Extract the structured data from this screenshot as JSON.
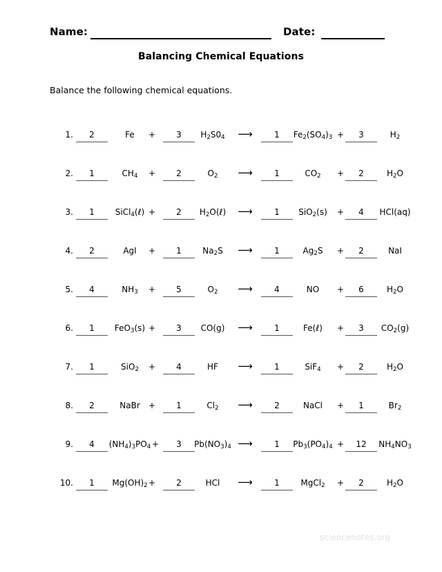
{
  "header": {
    "name_label": "Name:",
    "date_label": "Date:"
  },
  "title": "Balancing Chemical Equations",
  "instruction": "Balance the following chemical equations.",
  "footer": {
    "watermark": "sciencenotes.org"
  },
  "symbols": {
    "plus": "+",
    "arrow": "⟶"
  },
  "equations": [
    {
      "number": "1.",
      "coef1": "2",
      "species1": "Fe",
      "coef2": "3",
      "species2": "H<sub>2</sub>S0<sub>4</sub>",
      "coef3": "1",
      "species3": "Fe<sub>2</sub>(SO<sub>4</sub>)<sub>3</sub>",
      "coef4": "3",
      "species4": "H<sub>2</sub>"
    },
    {
      "number": "2.",
      "coef1": "1",
      "species1": "CH<sub>4</sub>",
      "coef2": "2",
      "species2": "O<sub>2</sub>",
      "coef3": "1",
      "species3": "CO<sub>2</sub>",
      "coef4": "2",
      "species4": "H<sub>2</sub>O"
    },
    {
      "number": "3.",
      "coef1": "1",
      "species1": "SiCl<sub>4</sub>(ℓ)",
      "coef2": "2",
      "species2": "H<sub>2</sub>O(ℓ)",
      "coef3": "1",
      "species3": "SiO<sub>2</sub>(s)",
      "coef4": "4",
      "species4": "HCl(aq)"
    },
    {
      "number": "4.",
      "coef1": "2",
      "species1": "AgI",
      "coef2": "1",
      "species2": "Na<sub>2</sub>S",
      "coef3": "1",
      "species3": "Ag<sub>2</sub>S",
      "coef4": "2",
      "species4": "NaI"
    },
    {
      "number": "5.",
      "coef1": "4",
      "species1": "NH<sub>3</sub>",
      "coef2": "5",
      "species2": "O<sub>2</sub>",
      "coef3": "4",
      "species3": "NO",
      "coef4": "6",
      "species4": "H<sub>2</sub>O"
    },
    {
      "number": "6.",
      "coef1": "1",
      "species1": "FeO<sub>3</sub>(s)",
      "coef2": "3",
      "species2": "CO(g)",
      "coef3": "1",
      "species3": "Fe(ℓ)",
      "coef4": "3",
      "species4": "CO<sub>2</sub>(g)"
    },
    {
      "number": "7.",
      "coef1": "1",
      "species1": "SiO<sub>2</sub>",
      "coef2": "4",
      "species2": "HF",
      "coef3": "1",
      "species3": "SiF<sub>4</sub>",
      "coef4": "2",
      "species4": "H<sub>2</sub>O"
    },
    {
      "number": "8.",
      "coef1": "2",
      "species1": "NaBr",
      "coef2": "1",
      "species2": "Cl<sub>2</sub>",
      "coef3": "2",
      "species3": "NaCl",
      "coef4": "1",
      "species4": "Br<sub>2</sub>"
    },
    {
      "number": "9.",
      "coef1": "4",
      "species1": "(NH<sub>4</sub>)<sub>3</sub>PO<sub>4</sub>",
      "coef2": "3",
      "species2": "Pb(NO<sub>3</sub>)<sub>4</sub>",
      "coef3": "1",
      "species3": "Pb<sub>3</sub>(PO<sub>4</sub>)<sub>4</sub>",
      "coef4": "12",
      "species4": "NH<sub>4</sub>NO<sub>3</sub>"
    },
    {
      "number": "10.",
      "coef1": "1",
      "species1": "Mg(OH)<sub>2</sub>",
      "coef2": "2",
      "species2": "HCl",
      "coef3": "1",
      "species3": "MgCl<sub>2</sub>",
      "coef4": "2",
      "species4": "H<sub>2</sub>O"
    }
  ]
}
